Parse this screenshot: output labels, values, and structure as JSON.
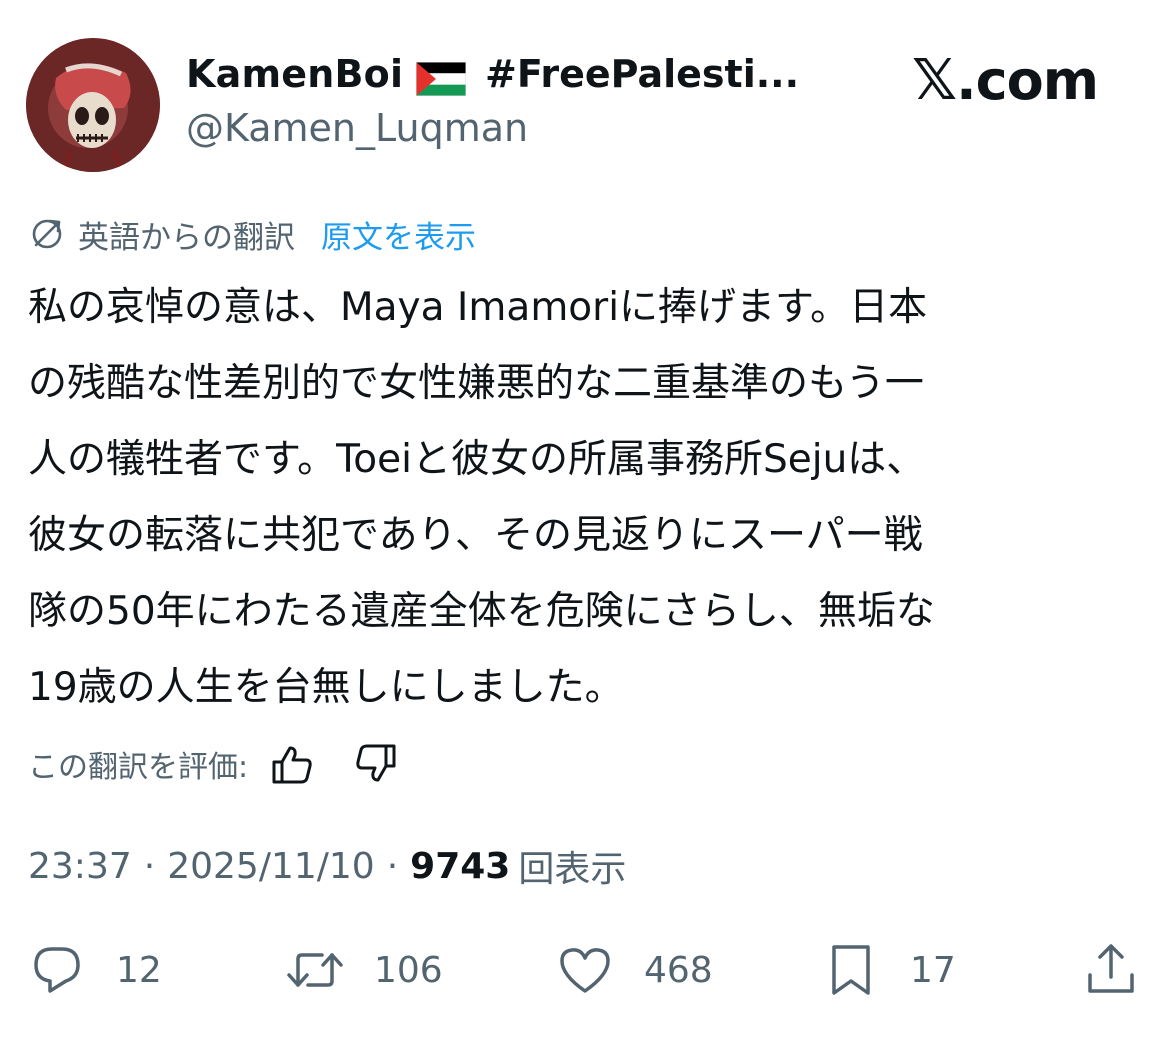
{
  "author": {
    "display_name": "KamenBoi",
    "display_name_tag": "#FreePalesti...",
    "handle": "@Kamen_Luqman"
  },
  "brand": {
    "x_glyph": "𝕏",
    "text": ".com"
  },
  "translation": {
    "label": "英語からの翻訳",
    "show_original": "原文を表示"
  },
  "tweet": {
    "lines": [
      "私の哀悼の意は、Maya Imamoriに捧げます。日本",
      "の残酷な性差別的で女性嫌悪的な二重基準のもう一",
      "人の犠牲者です。Toeiと彼女の所属事務所Sejuは、",
      "彼女の転落に共犯であり、その見返りにスーパー戦",
      "隊の50年にわたる遺産全体を危険にさらし、無垢な",
      "19歳の人生を台無しにしました。"
    ]
  },
  "rate": {
    "label": "この翻訳を評価:"
  },
  "meta": {
    "time": "23:37",
    "separator": "·",
    "date": "2025/11/10",
    "views_count": "9743",
    "views_label": "回表示"
  },
  "actions": {
    "reply_count": "12",
    "retweet_count": "106",
    "like_count": "468",
    "bookmark_count": "17"
  },
  "colors": {
    "text_primary": "#0f1419",
    "text_secondary": "#536471",
    "link": "#1d9bf0"
  },
  "icons": {
    "translate": "translate-icon",
    "thumbs_up": "thumbs-up-icon",
    "thumbs_down": "thumbs-down-icon",
    "reply": "reply-icon",
    "retweet": "retweet-icon",
    "like": "heart-icon",
    "bookmark": "bookmark-icon",
    "share": "share-icon"
  }
}
